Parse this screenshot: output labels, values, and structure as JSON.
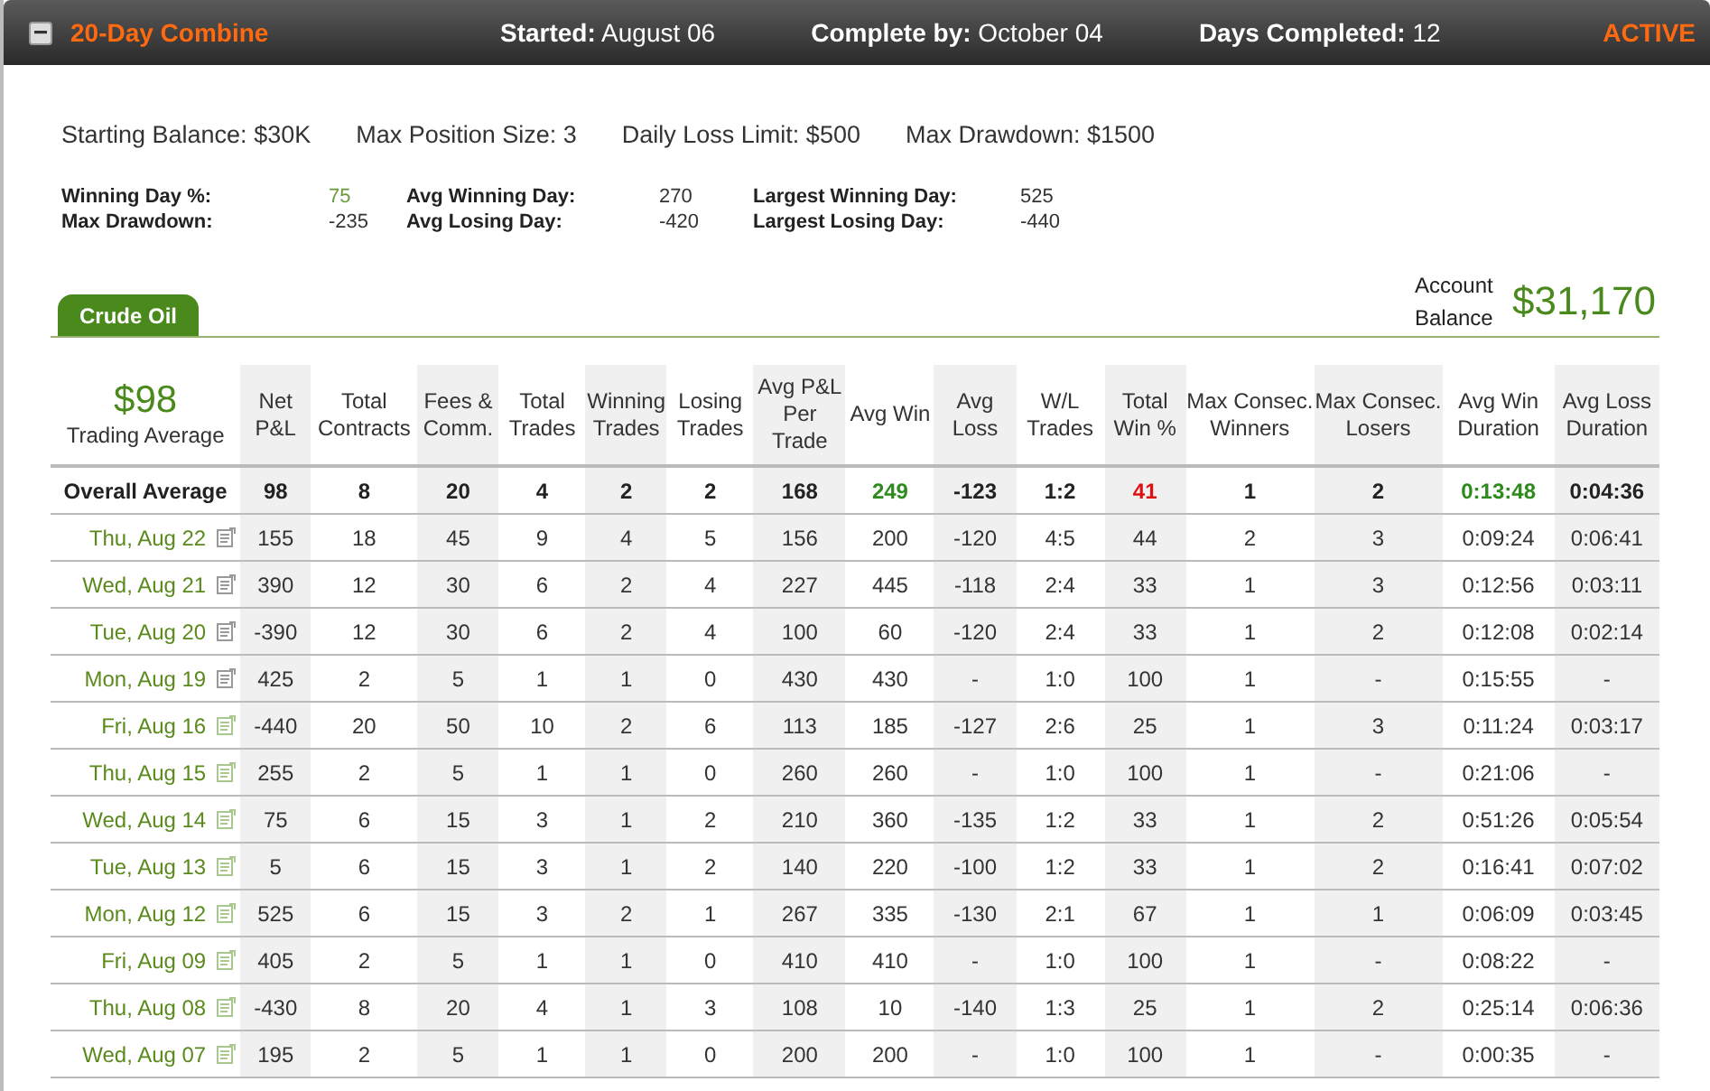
{
  "header": {
    "title": "20-Day Combine",
    "fields": [
      {
        "label": "Started:",
        "value": "August 06"
      },
      {
        "label": "Complete by:",
        "value": "October 04"
      },
      {
        "label": "Days Completed:",
        "value": "12"
      }
    ],
    "status": "ACTIVE"
  },
  "rules": [
    "Starting Balance: $30K",
    "Max Position Size: 3",
    "Daily Loss Limit: $500",
    "Max Drawdown: $1500"
  ],
  "stats": [
    {
      "label": "Winning Day %:",
      "value": "75",
      "positive": true
    },
    {
      "label": "Avg Winning Day:",
      "value": "270",
      "positive": false
    },
    {
      "label": "Largest Winning Day:",
      "value": "525",
      "positive": false
    },
    {
      "label": "Max Drawdown:",
      "value": "-235",
      "positive": false
    },
    {
      "label": "Avg Losing Day:",
      "value": "-420",
      "positive": false
    },
    {
      "label": "Largest Losing Day:",
      "value": "-440",
      "positive": false
    }
  ],
  "tabs": [
    {
      "label": "Crude Oil",
      "selected": true
    }
  ],
  "account_balance": {
    "label": "Account Balance",
    "value": "$31,170"
  },
  "table": {
    "average": {
      "value": "$98",
      "label": "Trading Average"
    },
    "columns": [
      "Net P&L",
      "Total Contracts",
      "Fees & Comm.",
      "Total Trades",
      "Winning Trades",
      "Losing Trades",
      "Avg P&L Per Trade",
      "Avg Win",
      "Avg Loss",
      "W/L Trades",
      "Total Win %",
      "Max Consec. Winners",
      "Max Consec. Losers",
      "Avg Win Duration",
      "Avg Loss Duration"
    ],
    "overall": {
      "label": "Overall Average",
      "cells": [
        {
          "text": "98",
          "color": "#222222"
        },
        {
          "text": "8",
          "color": "#222222"
        },
        {
          "text": "20",
          "color": "#222222"
        },
        {
          "text": "4",
          "color": "#222222"
        },
        {
          "text": "2",
          "color": "#222222"
        },
        {
          "text": "2",
          "color": "#222222"
        },
        {
          "text": "168",
          "color": "#222222"
        },
        {
          "text": "249",
          "color": "#2e8a1c"
        },
        {
          "text": "-123",
          "color": "#222222"
        },
        {
          "text": "1:2",
          "color": "#222222"
        },
        {
          "text": "41",
          "color": "#e01010"
        },
        {
          "text": "1",
          "color": "#222222"
        },
        {
          "text": "2",
          "color": "#222222"
        },
        {
          "text": "0:13:48",
          "color": "#2e8a1c"
        },
        {
          "text": "0:04:36",
          "color": "#222222"
        }
      ]
    },
    "rows": [
      {
        "date": "Thu, Aug 22",
        "has_note": true,
        "cells": [
          "155",
          "18",
          "45",
          "9",
          "4",
          "5",
          "156",
          "200",
          "-120",
          "4:5",
          "44",
          "2",
          "3",
          "0:09:24",
          "0:06:41"
        ]
      },
      {
        "date": "Wed, Aug 21",
        "has_note": true,
        "cells": [
          "390",
          "12",
          "30",
          "6",
          "2",
          "4",
          "227",
          "445",
          "-118",
          "2:4",
          "33",
          "1",
          "3",
          "0:12:56",
          "0:03:11"
        ]
      },
      {
        "date": "Tue, Aug 20",
        "has_note": true,
        "cells": [
          "-390",
          "12",
          "30",
          "6",
          "2",
          "4",
          "100",
          "60",
          "-120",
          "2:4",
          "33",
          "1",
          "2",
          "0:12:08",
          "0:02:14"
        ]
      },
      {
        "date": "Mon, Aug 19",
        "has_note": true,
        "cells": [
          "425",
          "2",
          "5",
          "1",
          "1",
          "0",
          "430",
          "430",
          "-",
          "1:0",
          "100",
          "1",
          "-",
          "0:15:55",
          "-"
        ]
      },
      {
        "date": "Fri, Aug 16",
        "has_note": false,
        "cells": [
          "-440",
          "20",
          "50",
          "10",
          "2",
          "6",
          "113",
          "185",
          "-127",
          "2:6",
          "25",
          "1",
          "3",
          "0:11:24",
          "0:03:17"
        ]
      },
      {
        "date": "Thu, Aug 15",
        "has_note": false,
        "cells": [
          "255",
          "2",
          "5",
          "1",
          "1",
          "0",
          "260",
          "260",
          "-",
          "1:0",
          "100",
          "1",
          "-",
          "0:21:06",
          "-"
        ]
      },
      {
        "date": "Wed, Aug 14",
        "has_note": false,
        "cells": [
          "75",
          "6",
          "15",
          "3",
          "1",
          "2",
          "210",
          "360",
          "-135",
          "1:2",
          "33",
          "1",
          "2",
          "0:51:26",
          "0:05:54"
        ]
      },
      {
        "date": "Tue, Aug 13",
        "has_note": false,
        "cells": [
          "5",
          "6",
          "15",
          "3",
          "1",
          "2",
          "140",
          "220",
          "-100",
          "1:2",
          "33",
          "1",
          "2",
          "0:16:41",
          "0:07:02"
        ]
      },
      {
        "date": "Mon, Aug 12",
        "has_note": false,
        "cells": [
          "525",
          "6",
          "15",
          "3",
          "2",
          "1",
          "267",
          "335",
          "-130",
          "2:1",
          "67",
          "1",
          "1",
          "0:06:09",
          "0:03:45"
        ]
      },
      {
        "date": "Fri, Aug 09",
        "has_note": false,
        "cells": [
          "405",
          "2",
          "5",
          "1",
          "1",
          "0",
          "410",
          "410",
          "-",
          "1:0",
          "100",
          "1",
          "-",
          "0:08:22",
          "-"
        ]
      },
      {
        "date": "Thu, Aug 08",
        "has_note": false,
        "cells": [
          "-430",
          "8",
          "20",
          "4",
          "1",
          "3",
          "108",
          "10",
          "-140",
          "1:3",
          "25",
          "1",
          "2",
          "0:25:14",
          "0:06:36"
        ]
      },
      {
        "date": "Wed, Aug 07",
        "has_note": false,
        "cells": [
          "195",
          "2",
          "5",
          "1",
          "1",
          "0",
          "200",
          "200",
          "-",
          "1:0",
          "100",
          "1",
          "-",
          "0:00:35",
          "-"
        ]
      }
    ]
  }
}
